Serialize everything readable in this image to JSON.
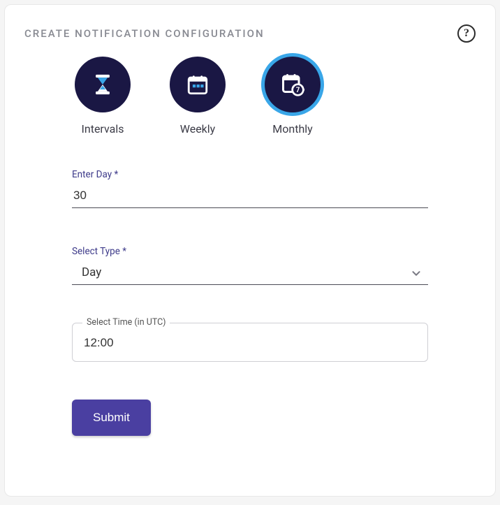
{
  "header": {
    "title": "CREATE NOTIFICATION CONFIGURATION"
  },
  "tabs": {
    "intervals": {
      "label": "Intervals"
    },
    "weekly": {
      "label": "Weekly"
    },
    "monthly": {
      "label": "Monthly"
    }
  },
  "form": {
    "day_label": "Enter Day *",
    "day_value": "30",
    "type_label": "Select Type *",
    "type_value": "Day",
    "time_label": "Select Time (in UTC)",
    "time_value": "12:00",
    "submit_label": "Submit"
  }
}
